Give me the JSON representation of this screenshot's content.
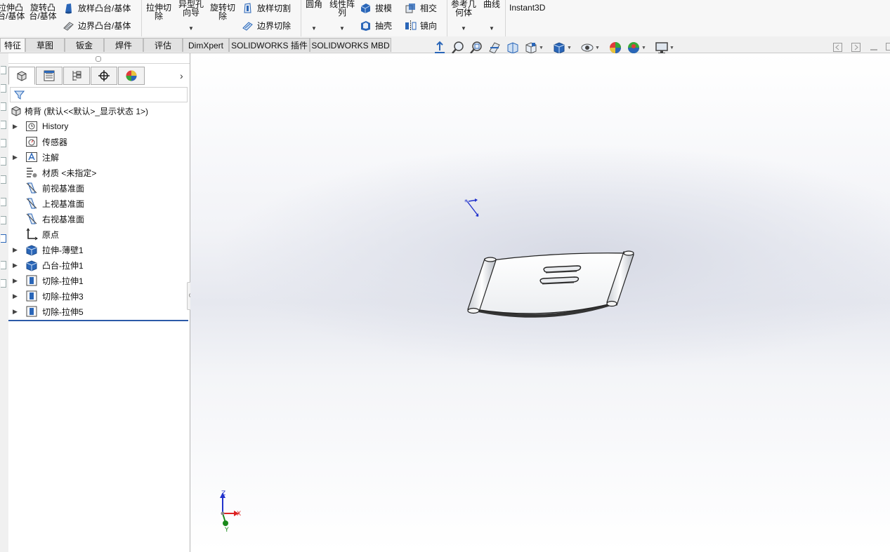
{
  "ribbon": {
    "extrude_boss": "拉伸凸\n台/基体",
    "revolve_boss": "旋转凸\n台/基体",
    "loft_boss": "放样凸台/基体",
    "boundary_boss": "边界凸台/基体",
    "extrude_cut": "拉伸切\n除",
    "hole_wizard": "异型孔\n向导",
    "revolve_cut": "旋转切\n除",
    "loft_cut": "放样切割",
    "boundary_cut": "边界切除",
    "fillet": "圆角",
    "linear_pattern": "线性阵\n列",
    "draft": "拔模",
    "shell": "抽壳",
    "intersect": "相交",
    "mirror": "镜向",
    "ref_geometry": "参考几\n何体",
    "curves": "曲线",
    "instant3d": "Instant3D"
  },
  "tabs": [
    {
      "label": "特征"
    },
    {
      "label": "草图"
    },
    {
      "label": "钣金"
    },
    {
      "label": "焊件"
    },
    {
      "label": "评估"
    },
    {
      "label": "DimXpert"
    },
    {
      "label": "SOLIDWORKS 插件"
    },
    {
      "label": "SOLIDWORKS MBD"
    }
  ],
  "feature_tree": {
    "root": "椅背 (默认<<默认>_显示状态 1>)",
    "items": [
      {
        "label": "History",
        "icon": "history-icon"
      },
      {
        "label": "传感器",
        "icon": "sensor-icon"
      },
      {
        "label": "注解",
        "icon": "annotation-icon"
      },
      {
        "label": "材质 <未指定>",
        "icon": "material-icon"
      },
      {
        "label": "前视基准面",
        "icon": "plane-icon"
      },
      {
        "label": "上视基准面",
        "icon": "plane-icon"
      },
      {
        "label": "右视基准面",
        "icon": "plane-icon"
      },
      {
        "label": "原点",
        "icon": "origin-icon"
      },
      {
        "label": "拉伸-薄壁1",
        "icon": "extrude-feature-icon"
      },
      {
        "label": "凸台-拉伸1",
        "icon": "extrude-feature-icon"
      },
      {
        "label": "切除-拉伸1",
        "icon": "cut-feature-icon"
      },
      {
        "label": "切除-拉伸3",
        "icon": "cut-feature-icon"
      },
      {
        "label": "切除-拉伸5",
        "icon": "cut-feature-icon"
      }
    ]
  },
  "triad": {
    "x": "X",
    "y": "Y",
    "z": "Z"
  },
  "colors": {
    "accent": "#2b5aa8",
    "triad_x": "#d22",
    "triad_y": "#1a8a1a",
    "triad_z": "#2233cc"
  }
}
